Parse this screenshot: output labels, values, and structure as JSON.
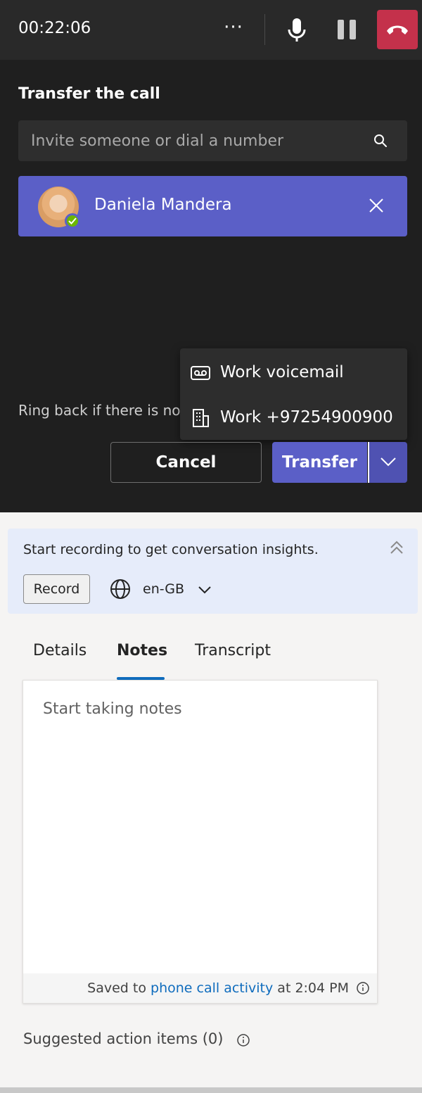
{
  "call": {
    "timer": "00:22:06",
    "more_label": "···"
  },
  "transfer": {
    "title": "Transfer the call",
    "search_placeholder": "Invite someone or dial a number",
    "selected_contact": "Daniela Mandera",
    "ringback_text": "Ring back if there is no a",
    "dropdown": [
      {
        "label": "Work voicemail",
        "icon": "voicemail-icon"
      },
      {
        "label": "Work +97254900900",
        "icon": "building-icon"
      }
    ],
    "cancel_label": "Cancel",
    "transfer_label": "Transfer"
  },
  "insights": {
    "banner_text": "Start recording to get conversation insights.",
    "record_label": "Record",
    "language": "en-GB"
  },
  "tabs": [
    {
      "label": "Details",
      "active": false
    },
    {
      "label": "Notes",
      "active": true
    },
    {
      "label": "Transcript",
      "active": false
    }
  ],
  "notes": {
    "placeholder": "Start taking notes",
    "saved_prefix": "Saved to ",
    "saved_link": "phone call activity",
    "saved_suffix": " at 2:04 PM"
  },
  "suggested": {
    "label": "Suggested action items (0)"
  },
  "colors": {
    "accent": "#5b5fc7",
    "end_call": "#c4314b",
    "link": "#0f6cbd",
    "presence": "#6bb700"
  }
}
